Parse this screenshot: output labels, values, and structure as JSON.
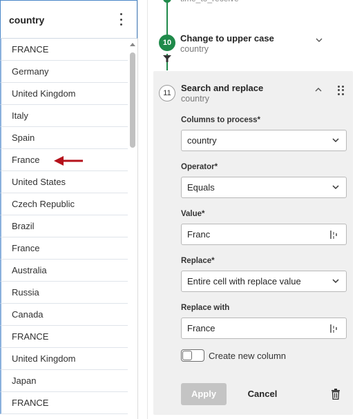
{
  "column_panel": {
    "title": "country",
    "rows": [
      "FRANCE",
      "Germany",
      "United Kingdom",
      "Italy",
      "Spain",
      "France",
      "United States",
      "Czech Republic",
      "Brazil",
      "France",
      "Australia",
      "Russia",
      "Canada",
      "FRANCE",
      "United Kingdom",
      "Japan",
      "FRANCE"
    ]
  },
  "steps": {
    "previous_label": "time_to_receive",
    "step10": {
      "number": "10",
      "title": "Change to upper case",
      "subtitle": "country"
    },
    "step11": {
      "number": "11",
      "title": "Search and replace",
      "subtitle": "country",
      "columns_label": "Columns to process*",
      "columns_value": "country",
      "operator_label": "Operator*",
      "operator_value": "Equals",
      "value_label": "Value*",
      "value_value": "Franc",
      "replace_label": "Replace*",
      "replace_value": "Entire cell with replace value",
      "replace_with_label": "Replace with",
      "replace_with_value": "France",
      "create_column_label": "Create new column",
      "create_column_checked": false,
      "apply_label": "Apply",
      "cancel_label": "Cancel"
    }
  },
  "colors": {
    "accent_green": "#1f8a4a",
    "annotation_arrow": "#b5121b",
    "apply_disabled": "#c4c4c4",
    "header_border": "#4a86c8"
  },
  "icons": [
    "kebab-menu-icon",
    "chevron-down-icon",
    "chevron-up-icon",
    "filter-icon",
    "drag-handle-icon",
    "formula-icon",
    "trash-icon",
    "annotation-arrow-icon"
  ]
}
